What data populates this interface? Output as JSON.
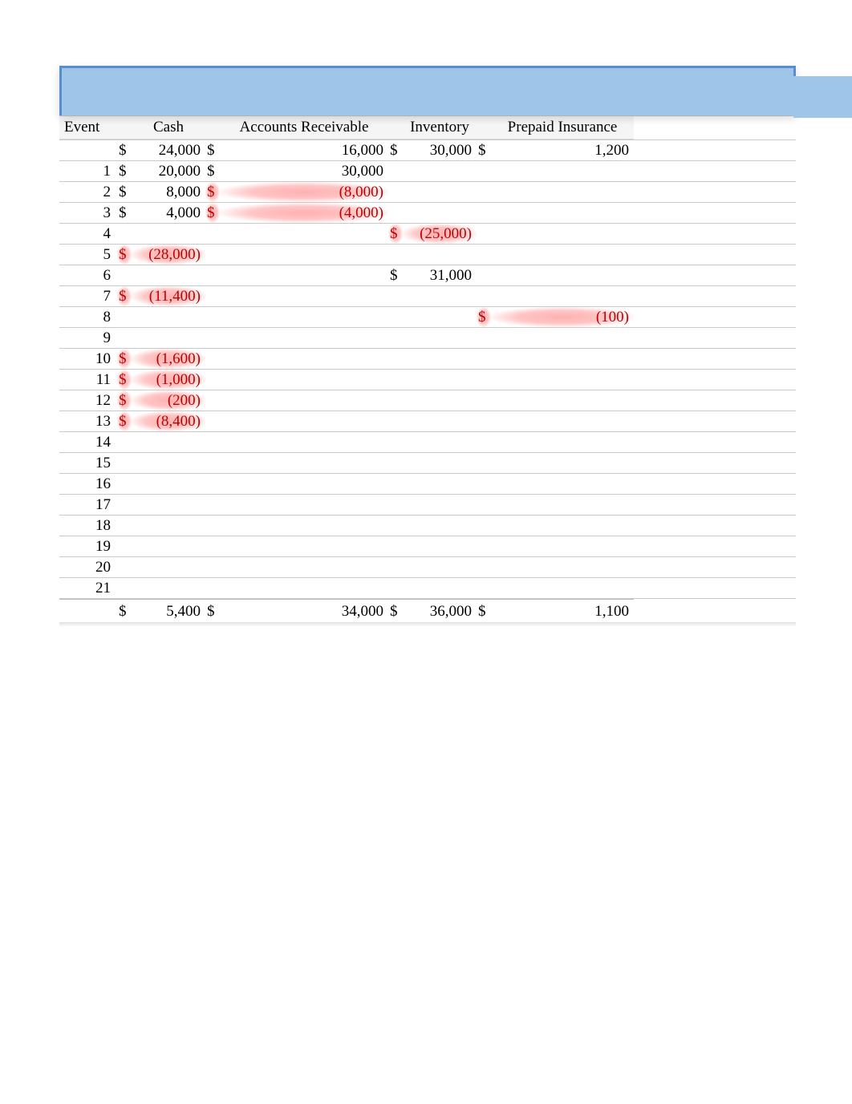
{
  "headers": {
    "event": "Event",
    "cash": "Cash",
    "ar": "Accounts Receivable",
    "inventory": "Inventory",
    "prepaid": "Prepaid Insurance"
  },
  "currency": "$",
  "opening": {
    "cash_cur": "$",
    "cash": "24,000",
    "ar_cur": "$",
    "ar": "16,000",
    "inv_cur": "$",
    "inv": "30,000",
    "pre_cur": "$",
    "pre": "1,200"
  },
  "rows": [
    {
      "ev": "1",
      "cash_cur": "$",
      "cash": "20,000",
      "cash_neg": false,
      "ar_cur": "$",
      "ar": "30,000",
      "ar_neg": false
    },
    {
      "ev": "2",
      "cash_cur": "$",
      "cash": "8,000",
      "cash_neg": false,
      "ar_cur": "$",
      "ar": "(8,000)",
      "ar_neg": true
    },
    {
      "ev": "3",
      "cash_cur": "$",
      "cash": "4,000",
      "cash_neg": false,
      "ar_cur": "$",
      "ar": "(4,000)",
      "ar_neg": true
    },
    {
      "ev": "4",
      "inv_cur": "$",
      "inv": "(25,000)",
      "inv_neg": true
    },
    {
      "ev": "5",
      "cash_cur": "$",
      "cash": "(28,000)",
      "cash_neg": true
    },
    {
      "ev": "6",
      "inv_cur": "$",
      "inv": "31,000",
      "inv_neg": false
    },
    {
      "ev": "7",
      "cash_cur": "$",
      "cash": "(11,400)",
      "cash_neg": true
    },
    {
      "ev": "8",
      "pre_cur": "$",
      "pre": "(100)",
      "pre_neg": true
    },
    {
      "ev": "9"
    },
    {
      "ev": "10",
      "cash_cur": "$",
      "cash": "(1,600)",
      "cash_neg": true
    },
    {
      "ev": "11",
      "cash_cur": "$",
      "cash": "(1,000)",
      "cash_neg": true
    },
    {
      "ev": "12",
      "cash_cur": "$",
      "cash": "(200)",
      "cash_neg": true
    },
    {
      "ev": "13",
      "cash_cur": "$",
      "cash": "(8,400)",
      "cash_neg": true
    },
    {
      "ev": "14"
    },
    {
      "ev": "15"
    },
    {
      "ev": "16"
    },
    {
      "ev": "17"
    },
    {
      "ev": "18"
    },
    {
      "ev": "19"
    },
    {
      "ev": "20"
    },
    {
      "ev": "21"
    }
  ],
  "totals": {
    "cash_cur": "$",
    "cash": "5,400",
    "ar_cur": "$",
    "ar": "34,000",
    "inv_cur": "$",
    "inv": "36,000",
    "pre_cur": "$",
    "pre": "1,100"
  },
  "chart_data": {
    "type": "table",
    "title": "",
    "columns": [
      "Event",
      "Cash",
      "Accounts Receivable",
      "Inventory",
      "Prepaid Insurance"
    ],
    "opening_balances": {
      "Cash": 24000,
      "Accounts Receivable": 16000,
      "Inventory": 30000,
      "Prepaid Insurance": 1200
    },
    "events": [
      {
        "event": 1,
        "Cash": 20000,
        "Accounts Receivable": 30000
      },
      {
        "event": 2,
        "Cash": 8000,
        "Accounts Receivable": -8000
      },
      {
        "event": 3,
        "Cash": 4000,
        "Accounts Receivable": -4000
      },
      {
        "event": 4,
        "Inventory": -25000
      },
      {
        "event": 5,
        "Cash": -28000
      },
      {
        "event": 6,
        "Inventory": 31000
      },
      {
        "event": 7,
        "Cash": -11400
      },
      {
        "event": 8,
        "Prepaid Insurance": -100
      },
      {
        "event": 9
      },
      {
        "event": 10,
        "Cash": -1600
      },
      {
        "event": 11,
        "Cash": -1000
      },
      {
        "event": 12,
        "Cash": -200
      },
      {
        "event": 13,
        "Cash": -8400
      },
      {
        "event": 14
      },
      {
        "event": 15
      },
      {
        "event": 16
      },
      {
        "event": 17
      },
      {
        "event": 18
      },
      {
        "event": 19
      },
      {
        "event": 20
      },
      {
        "event": 21
      }
    ],
    "totals": {
      "Cash": 5400,
      "Accounts Receivable": 34000,
      "Inventory": 36000,
      "Prepaid Insurance": 1100
    }
  }
}
